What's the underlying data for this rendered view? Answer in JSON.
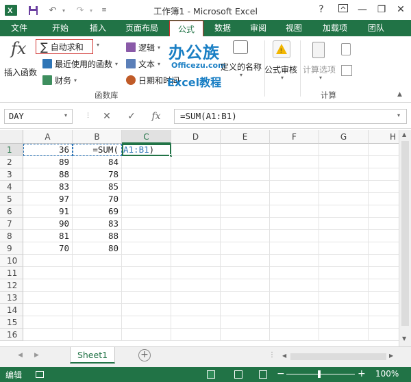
{
  "window": {
    "title": "工作簿1 - Microsoft Excel",
    "help": "?",
    "minimize": "—",
    "restore": "❐",
    "close": "✕"
  },
  "tabs": [
    {
      "label": "文件"
    },
    {
      "label": "开始"
    },
    {
      "label": "插入"
    },
    {
      "label": "页面布局"
    },
    {
      "label": "公式"
    },
    {
      "label": "数据"
    },
    {
      "label": "审阅"
    },
    {
      "label": "视图"
    },
    {
      "label": "加载项"
    },
    {
      "label": "团队"
    }
  ],
  "ribbon": {
    "insert_function": "插入函数",
    "fx_glyph": "fx",
    "autosum": "自动求和",
    "recent": "最近使用的函数",
    "finance": "财务",
    "logic": "逻辑",
    "text": "文本",
    "datetime": "日期和时间",
    "define_name": "定义的名称",
    "formula_audit": "公式审核",
    "calc_options": "计算选项",
    "group_library": "函数库",
    "group_calc": "计算"
  },
  "watermark": {
    "line1": "办公族",
    "line2": "Officezu.com",
    "line3": "Excel教程"
  },
  "formula_bar": {
    "name_box": "DAY",
    "formula": "=SUM(A1:B1)",
    "cancel": "✕",
    "enter": "✓",
    "fx": "fx"
  },
  "grid": {
    "columns": [
      "A",
      "B",
      "C",
      "D",
      "E",
      "F",
      "G",
      "H"
    ],
    "rows": [
      "1",
      "2",
      "3",
      "4",
      "5",
      "6",
      "7",
      "8",
      "9",
      "10",
      "11",
      "12",
      "13",
      "14",
      "15",
      "16"
    ],
    "colA": [
      "36",
      "89",
      "88",
      "83",
      "97",
      "91",
      "90",
      "81",
      "70"
    ],
    "colB": [
      "",
      "84",
      "78",
      "85",
      "70",
      "69",
      "83",
      "88",
      "80"
    ],
    "b1_editing": "=SUM(",
    "b1_ref": "A1:B1",
    "b1_close": ")"
  },
  "sheet": {
    "tab": "Sheet1",
    "add": "+"
  },
  "status": {
    "mode": "编辑",
    "zoom": "100%",
    "zoom_minus": "−",
    "zoom_plus": "+"
  },
  "colors": {
    "excel_green": "#217346",
    "highlight_red": "#d0312d",
    "ref_blue": "#2e75b6"
  }
}
